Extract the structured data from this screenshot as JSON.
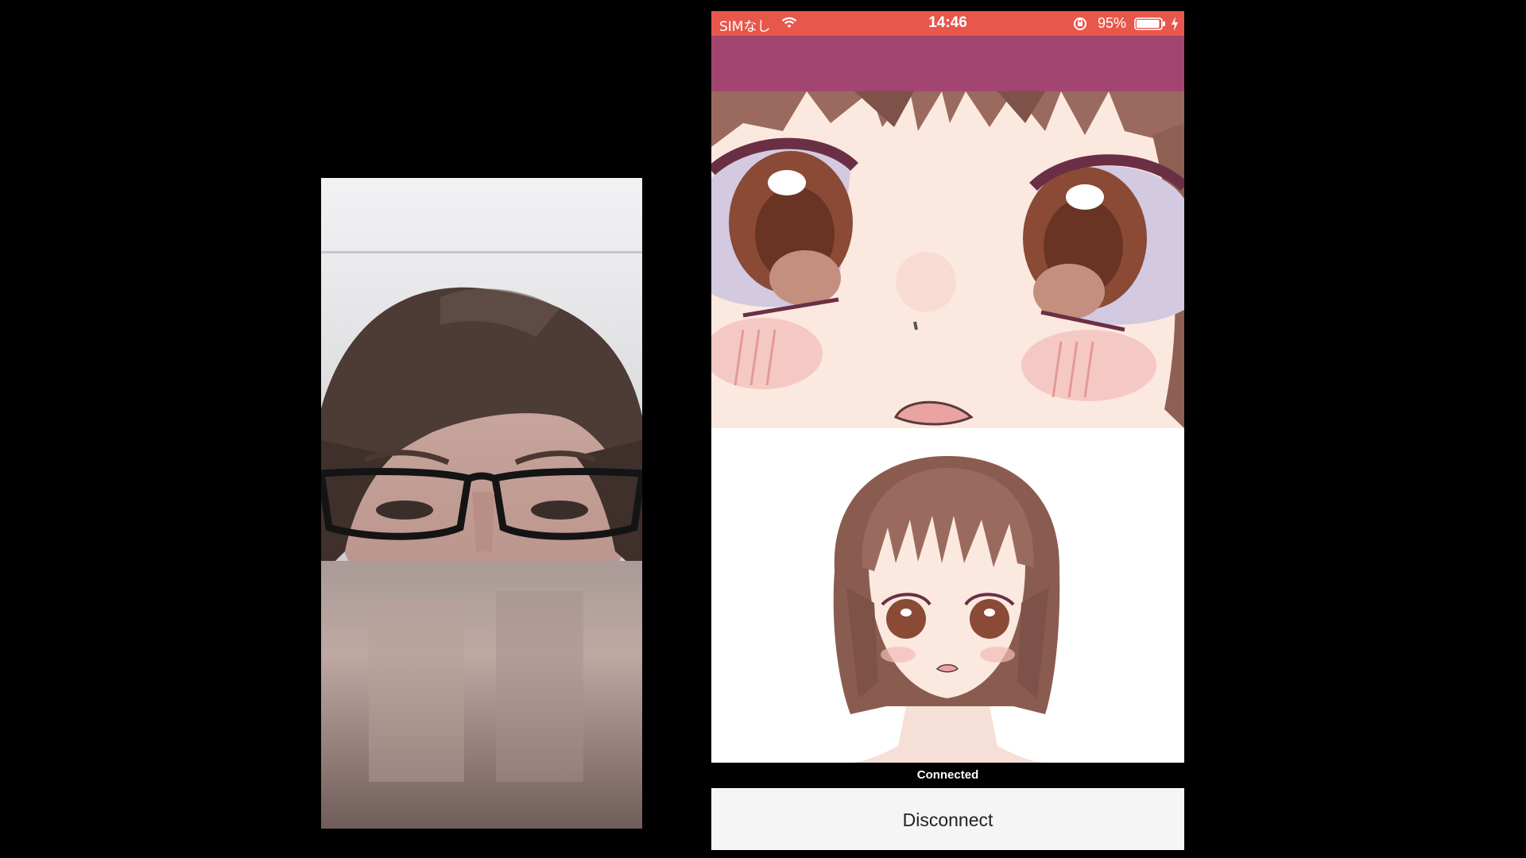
{
  "status_bar": {
    "carrier": "SIMなし",
    "time": "14:46",
    "battery_percent": "95%",
    "battery_level": 0.95,
    "icons": [
      "wifi-icon",
      "orientation-lock-icon",
      "battery-icon",
      "charging-bolt-icon"
    ]
  },
  "connection": {
    "status": "Connected",
    "button_label": "Disconnect"
  },
  "colors": {
    "status_bar": "#e8574b",
    "nav_bar": "#a24570",
    "background": "#000000"
  }
}
